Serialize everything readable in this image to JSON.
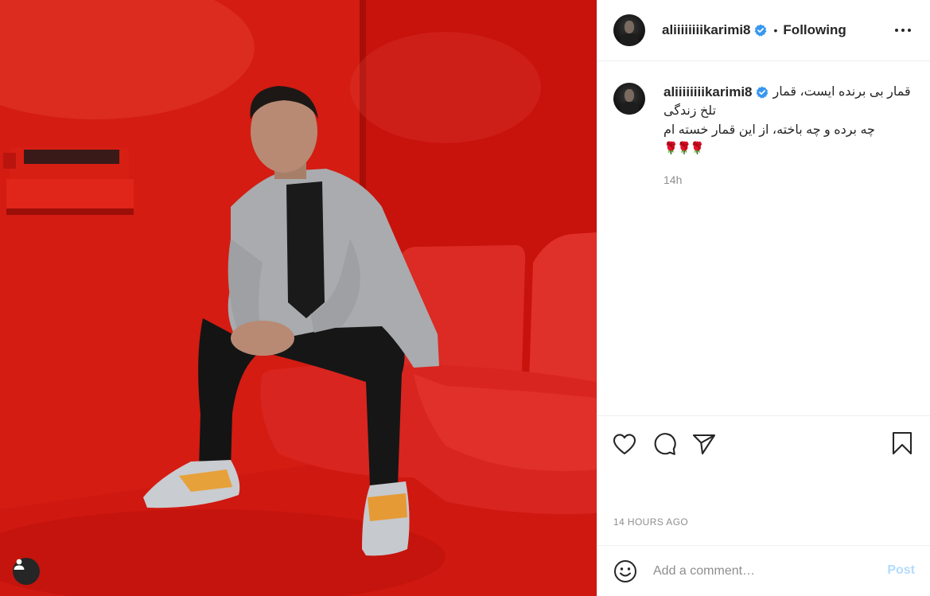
{
  "post": {
    "username": "aliiiiiiiikarimi8",
    "follow_separator": "•",
    "follow_status": "Following",
    "caption": {
      "line1": "قمار بی برنده ایست، قمار",
      "line2": "تلخ زندگی",
      "line3": "چه برده و چه باخته، از این قمار خسته ام",
      "emojis": "🌹🌹🌹"
    },
    "caption_time": "14h",
    "posted_time": "14 HOURS AGO",
    "comment": {
      "placeholder": "Add a comment…",
      "post_label": "Post"
    }
  },
  "icons": {
    "avatar": "avatar",
    "verified": "verified-badge-icon",
    "more": "more-options-icon",
    "like": "heart-icon",
    "comment": "comment-icon",
    "share": "paper-plane-icon",
    "save": "bookmark-icon",
    "emoji": "smiley-icon",
    "user_tag": "user-tag-icon"
  },
  "colors": {
    "verified_blue": "#3897f0",
    "post_button_disabled": "#b3dbff",
    "media_background": "#d01a12"
  }
}
